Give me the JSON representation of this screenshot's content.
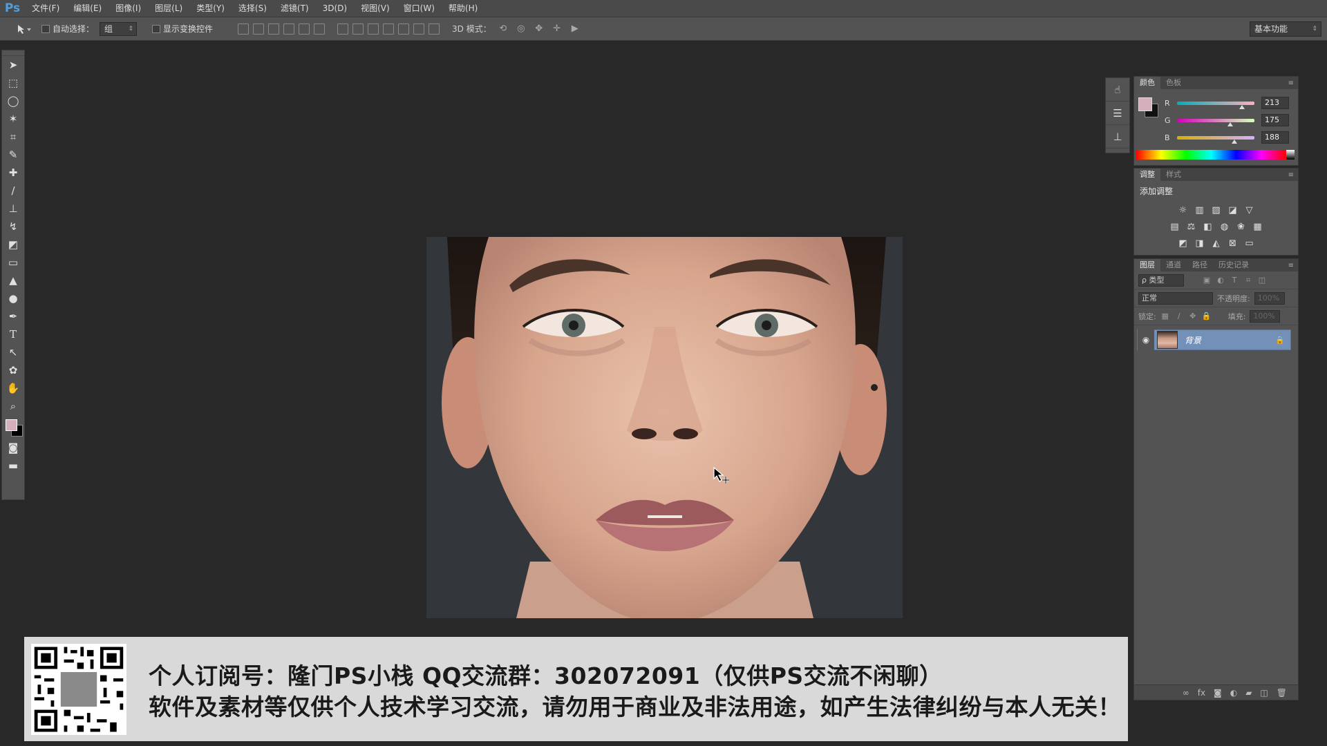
{
  "app": {
    "logo": "Ps"
  },
  "menu": [
    "文件(F)",
    "编辑(E)",
    "图像(I)",
    "图层(L)",
    "类型(Y)",
    "选择(S)",
    "滤镜(T)",
    "3D(D)",
    "视图(V)",
    "窗口(W)",
    "帮助(H)"
  ],
  "options": {
    "auto_select_label": "自动选择：",
    "auto_select_value": "组",
    "show_transform_label": "显示变换控件",
    "mode_label": "3D 模式：",
    "workspace": "基本功能"
  },
  "tools": [
    "move-tool",
    "marquee-tool",
    "lasso-tool",
    "magic-wand-tool",
    "crop-tool",
    "eyedropper-tool",
    "healing-brush-tool",
    "brush-tool",
    "clone-stamp-tool",
    "history-brush-tool",
    "eraser-tool",
    "gradient-tool",
    "blur-tool",
    "dodge-tool",
    "pen-tool",
    "type-tool",
    "path-selection-tool",
    "shape-tool",
    "hand-tool",
    "zoom-tool"
  ],
  "colors": {
    "foreground": "#d5afbc",
    "background": "#000000",
    "layer_selected": "#7390b8"
  },
  "color_panel": {
    "tabs": [
      "颜色",
      "色板"
    ],
    "channels": [
      {
        "name": "R",
        "value": "213"
      },
      {
        "name": "G",
        "value": "175"
      },
      {
        "name": "B",
        "value": "188"
      }
    ]
  },
  "adjust_panel": {
    "tabs": [
      "调整",
      "样式"
    ],
    "title": "添加调整"
  },
  "layers_panel": {
    "tabs": [
      "图层",
      "通道",
      "路径",
      "历史记录"
    ],
    "filter_label": "ρ 类型",
    "blend_mode": "正常",
    "opacity_label": "不透明度:",
    "opacity_value": "100%",
    "lock_label": "锁定:",
    "fill_label": "填充:",
    "fill_value": "100%",
    "layers": [
      {
        "name": "背景",
        "visible": true,
        "locked": true
      }
    ]
  },
  "banner": {
    "line1": "个人订阅号：隆门PS小栈    QQ交流群：302072091（仅供PS交流不闲聊）",
    "line2": "软件及素材等仅供个人技术学习交流，请勿用于商业及非法用途，如产生法律纠纷与本人无关！"
  }
}
